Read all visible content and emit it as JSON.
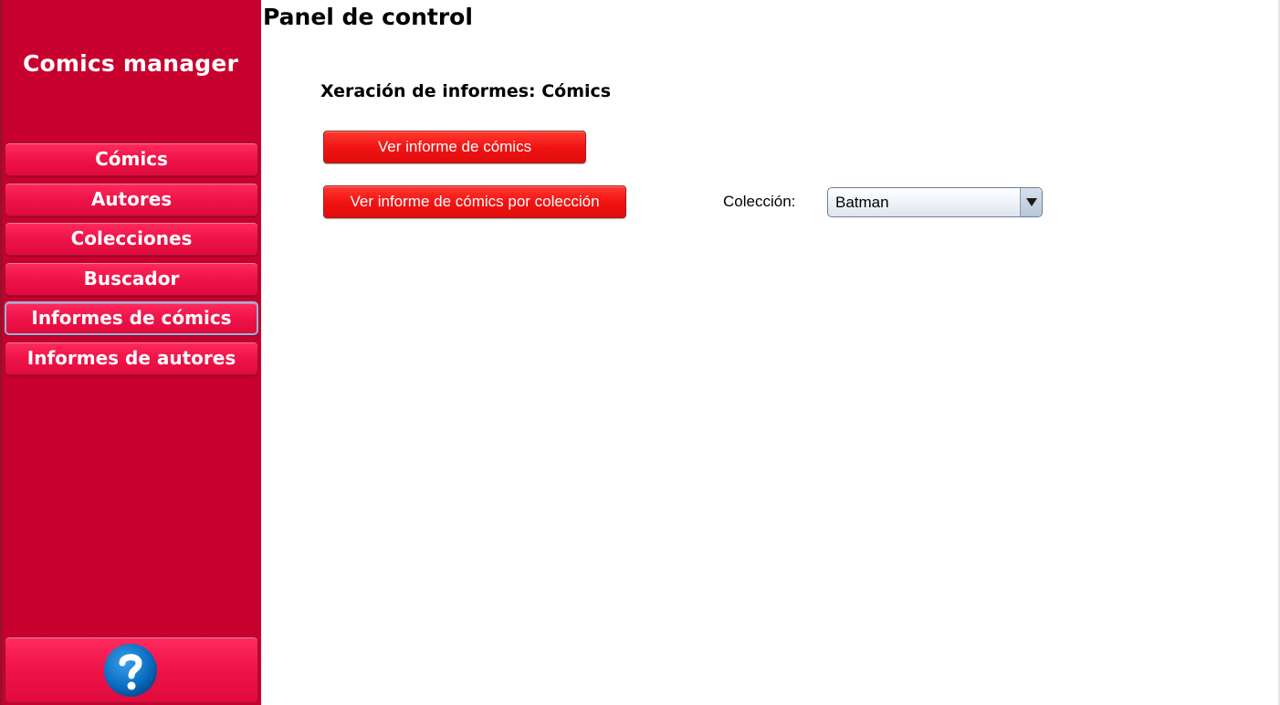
{
  "sidebar": {
    "app_title": "Comics manager",
    "items": [
      {
        "label": "Cómics"
      },
      {
        "label": "Autores"
      },
      {
        "label": "Colecciones"
      },
      {
        "label": "Buscador"
      },
      {
        "label": "Informes de cómics"
      },
      {
        "label": "Informes de autores"
      }
    ],
    "active_item": "Informes de cómics",
    "help_icon": "question-mark-icon"
  },
  "main": {
    "page_title": "Panel de control",
    "section_title": "Xeración de informes: Cómics",
    "report_comics_button": "Ver informe de cómics",
    "report_collection_button": "Ver informe de cómics por colección",
    "collection_label": "Colección:",
    "collection_selected": "Batman"
  },
  "colors": {
    "sidebar_bg": "#c8002e",
    "nav_button": "#f0154a",
    "action_button": "#f21414",
    "active_border": "#8fb6dc"
  }
}
